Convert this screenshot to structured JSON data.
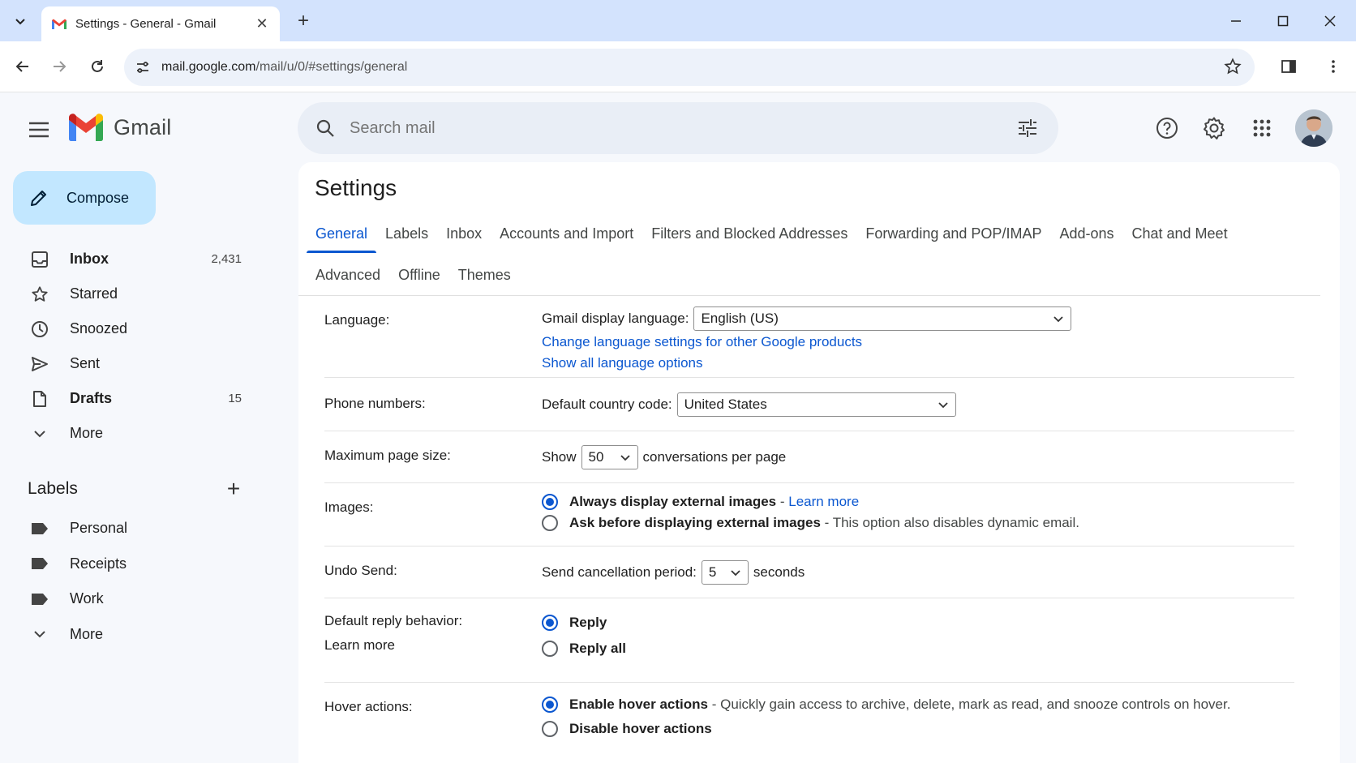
{
  "browser": {
    "tab_title": "Settings - General - Gmail",
    "url_host": "mail.google.com",
    "url_path": "/mail/u/0/#settings/general"
  },
  "app": {
    "name": "Gmail",
    "search_placeholder": "Search mail"
  },
  "sidebar": {
    "compose_label": "Compose",
    "items": [
      {
        "label": "Inbox",
        "count": "2,431",
        "icon": "inbox-icon"
      },
      {
        "label": "Starred",
        "count": "",
        "icon": "star-icon"
      },
      {
        "label": "Snoozed",
        "count": "",
        "icon": "clock-icon"
      },
      {
        "label": "Sent",
        "count": "",
        "icon": "send-icon"
      },
      {
        "label": "Drafts",
        "count": "15",
        "icon": "draft-icon"
      },
      {
        "label": "More",
        "count": "",
        "icon": "chevron-down-icon"
      }
    ],
    "labels_title": "Labels",
    "labels": [
      {
        "label": "Personal",
        "icon": "label-icon"
      },
      {
        "label": "Receipts",
        "icon": "label-icon"
      },
      {
        "label": "Work",
        "icon": "label-icon"
      },
      {
        "label": "More",
        "icon": "chevron-down-icon"
      }
    ]
  },
  "settings": {
    "title": "Settings",
    "tabs_row1": [
      "General",
      "Labels",
      "Inbox",
      "Accounts and Import",
      "Filters and Blocked Addresses",
      "Forwarding and POP/IMAP",
      "Add-ons",
      "Chat and Meet"
    ],
    "tabs_row2": [
      "Advanced",
      "Offline",
      "Themes"
    ],
    "active_tab": "General",
    "language": {
      "label": "Language:",
      "display_label": "Gmail display language:",
      "display_value": "English (US)",
      "link1": "Change language settings for other Google products",
      "link2": "Show all language options"
    },
    "phone": {
      "label": "Phone numbers:",
      "country_label": "Default country code:",
      "country_value": "United States"
    },
    "page_size": {
      "label": "Maximum page size:",
      "show": "Show",
      "value": "50",
      "suffix": "conversations per page"
    },
    "images": {
      "label": "Images:",
      "opt1": "Always display external images",
      "opt1_sep": " - ",
      "opt1_link": "Learn more",
      "opt2": "Ask before displaying external images",
      "opt2_note": " - This option also disables dynamic email.",
      "selected": "Always display external images"
    },
    "undo_send": {
      "label": "Undo Send:",
      "period_label": "Send cancellation period:",
      "value": "5",
      "suffix": "seconds"
    },
    "reply": {
      "label": "Default reply behavior:",
      "learn_more": "Learn more",
      "opt1": "Reply",
      "opt2": "Reply all",
      "selected": "Reply"
    },
    "hover": {
      "label": "Hover actions:",
      "opt1": "Enable hover actions",
      "opt1_note": " - Quickly gain access to archive, delete, mark as read, and snooze controls on hover.",
      "opt2": "Disable hover actions",
      "selected": "Enable hover actions"
    }
  },
  "colors": {
    "accent": "#0b57d0",
    "compose_bg": "#c2e7ff",
    "app_bg": "#f6f8fc",
    "tabstrip_bg": "#d3e3fd"
  }
}
